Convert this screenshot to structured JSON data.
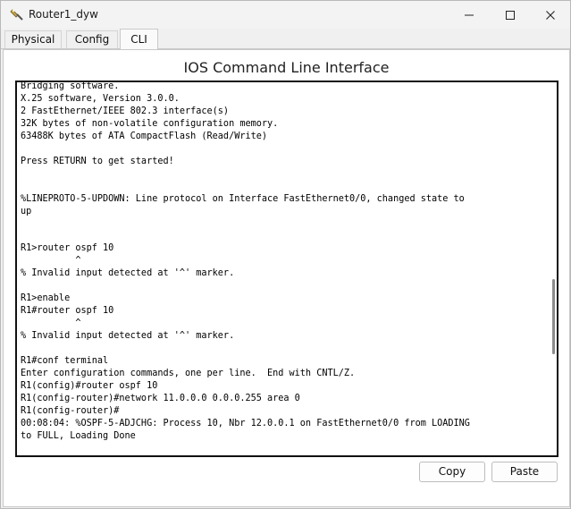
{
  "window": {
    "title": "Router1_dyw",
    "icon": "router-icon"
  },
  "tabs": [
    {
      "label": "Physical"
    },
    {
      "label": "Config"
    },
    {
      "label": "CLI"
    }
  ],
  "panel": {
    "title": "IOS Command Line Interface"
  },
  "terminal": {
    "text": "Bridging software.\nX.25 software, Version 3.0.0.\n2 FastEthernet/IEEE 802.3 interface(s)\n32K bytes of non-volatile configuration memory.\n63488K bytes of ATA CompactFlash (Read/Write)\n\nPress RETURN to get started!\n\n\n%LINEPROTO-5-UPDOWN: Line protocol on Interface FastEthernet0/0, changed state to\nup\n\n\nR1>router ospf 10\n          ^\n% Invalid input detected at '^' marker.\n\nR1>enable\nR1#router ospf 10\n          ^\n% Invalid input detected at '^' marker.\n\nR1#conf terminal\nEnter configuration commands, one per line.  End with CNTL/Z.\nR1(config)#router ospf 10\nR1(config-router)#network 11.0.0.0 0.0.0.255 area 0\nR1(config-router)#\n00:08:04: %OSPF-5-ADJCHG: Process 10, Nbr 12.0.0.1 on FastEthernet0/0 from LOADING\nto FULL, Loading Done"
  },
  "buttons": {
    "copy": "Copy",
    "paste": "Paste"
  }
}
